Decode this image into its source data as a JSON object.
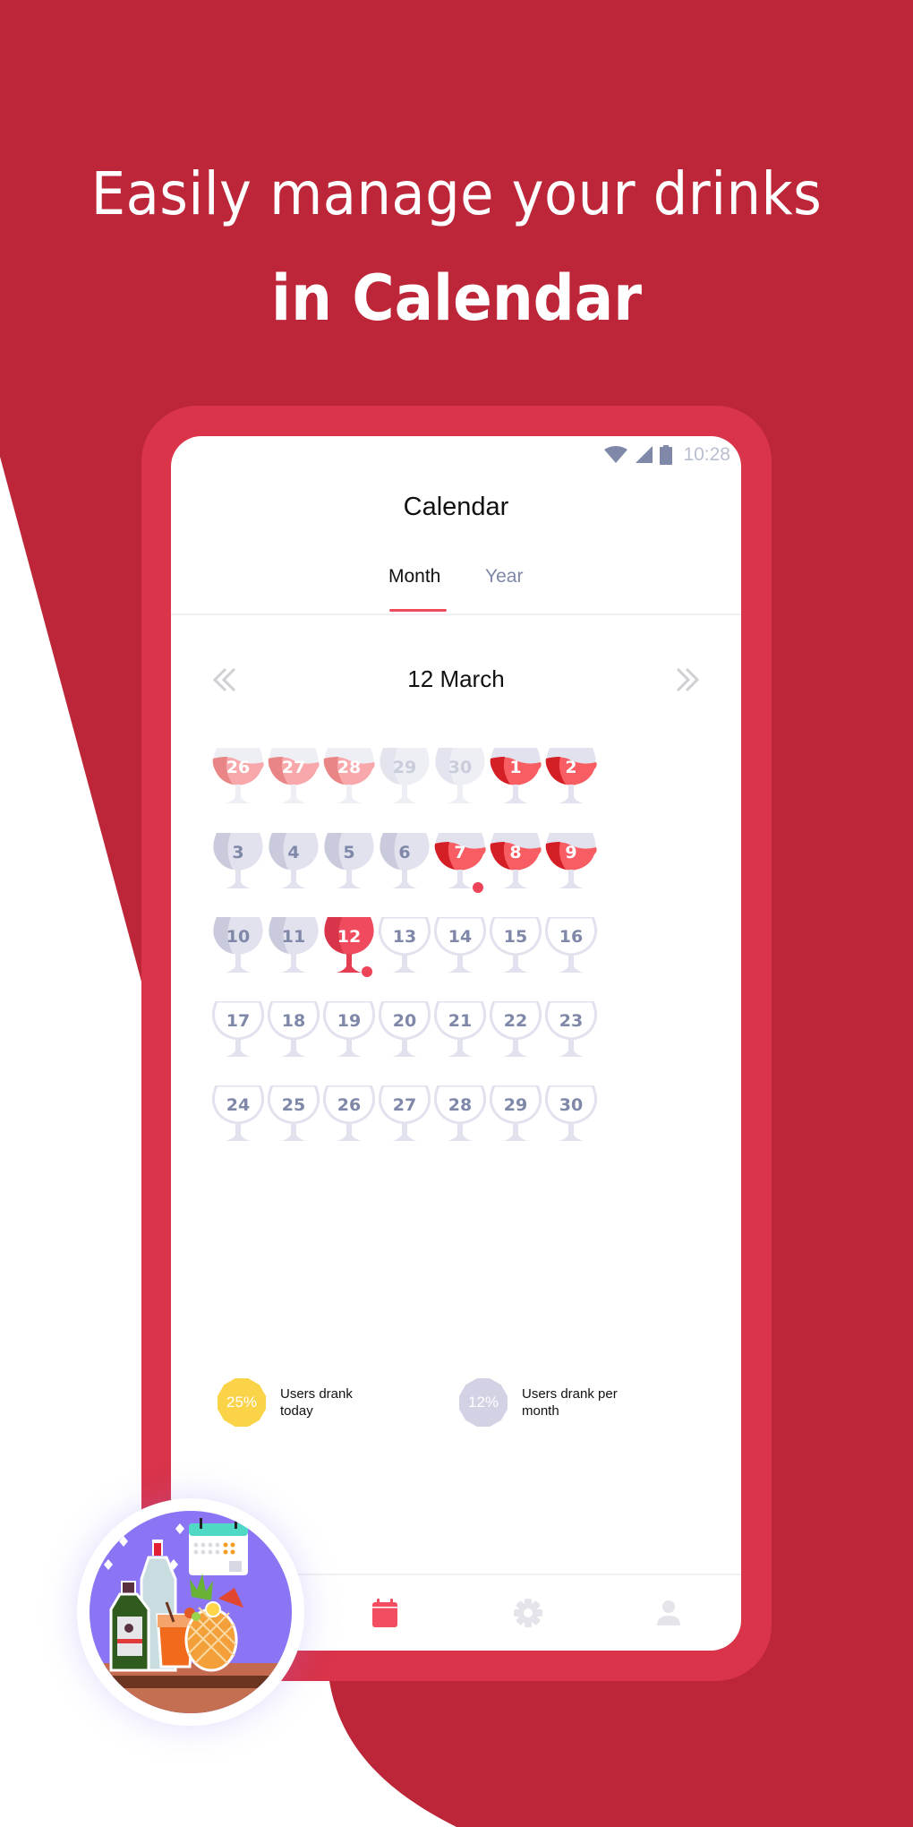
{
  "promo": {
    "line1": "Easily manage your drinks",
    "line2": "in Calendar"
  },
  "colors": {
    "background": "#bd2538",
    "frame": "#d9344a",
    "accent": "#ef4d5e",
    "wine_dark": "#d41f26",
    "wine_light": "#f75d62",
    "wine_faded_dark": "#e98585",
    "wine_faded_light": "#f8a8aa",
    "glass": "#e1e2ee",
    "glass_shade": "#c9cadb",
    "text_muted": "#7f88a8",
    "badge_yellow": "#fbd349",
    "badge_lavender": "#d3d2e5"
  },
  "status_bar": {
    "icons": [
      "wifi-icon",
      "signal-icon",
      "battery-icon"
    ],
    "time": "10:28"
  },
  "screen": {
    "title": "Calendar",
    "tabs": [
      {
        "label": "Month",
        "active": true
      },
      {
        "label": "Year",
        "active": false
      }
    ],
    "month_nav": {
      "label": "12 March",
      "prev_icon": "double-chevron-left-icon",
      "next_icon": "double-chevron-right-icon"
    }
  },
  "calendar": {
    "weeks": [
      [
        {
          "day": "26",
          "state": "faded-filled",
          "other_month": true
        },
        {
          "day": "27",
          "state": "faded-filled",
          "other_month": true
        },
        {
          "day": "28",
          "state": "faded-filled",
          "other_month": true
        },
        {
          "day": "29",
          "state": "faded-empty",
          "other_month": true
        },
        {
          "day": "30",
          "state": "faded-empty",
          "other_month": true
        },
        {
          "day": "1",
          "state": "filled"
        },
        {
          "day": "2",
          "state": "filled"
        }
      ],
      [
        {
          "day": "3",
          "state": "empty"
        },
        {
          "day": "4",
          "state": "empty"
        },
        {
          "day": "5",
          "state": "empty"
        },
        {
          "day": "6",
          "state": "empty"
        },
        {
          "day": "7",
          "state": "filled",
          "marker": true
        },
        {
          "day": "8",
          "state": "filled"
        },
        {
          "day": "9",
          "state": "filled"
        }
      ],
      [
        {
          "day": "10",
          "state": "empty"
        },
        {
          "day": "11",
          "state": "empty"
        },
        {
          "day": "12",
          "state": "selected",
          "marker": true
        },
        {
          "day": "13",
          "state": "future"
        },
        {
          "day": "14",
          "state": "future"
        },
        {
          "day": "15",
          "state": "future"
        },
        {
          "day": "16",
          "state": "future"
        }
      ],
      [
        {
          "day": "17",
          "state": "future"
        },
        {
          "day": "18",
          "state": "future"
        },
        {
          "day": "19",
          "state": "future"
        },
        {
          "day": "20",
          "state": "future"
        },
        {
          "day": "21",
          "state": "future"
        },
        {
          "day": "22",
          "state": "future"
        },
        {
          "day": "23",
          "state": "future"
        }
      ],
      [
        {
          "day": "24",
          "state": "future"
        },
        {
          "day": "25",
          "state": "future"
        },
        {
          "day": "26",
          "state": "future"
        },
        {
          "day": "27",
          "state": "future"
        },
        {
          "day": "28",
          "state": "future"
        },
        {
          "day": "29",
          "state": "future"
        },
        {
          "day": "30",
          "state": "future"
        }
      ]
    ]
  },
  "stats": [
    {
      "value": "25%",
      "label": "Users drank today",
      "color": "#fbd349"
    },
    {
      "value": "12%",
      "label": "Users drank per month",
      "color": "#d3d2e5"
    }
  ],
  "bottom_nav": [
    {
      "icon": "calendar-icon",
      "active": true
    },
    {
      "icon": "gear-icon",
      "active": false
    },
    {
      "icon": "person-icon",
      "active": false
    }
  ],
  "logo": {
    "icon": "app-logo-drinks-calendar-icon"
  }
}
